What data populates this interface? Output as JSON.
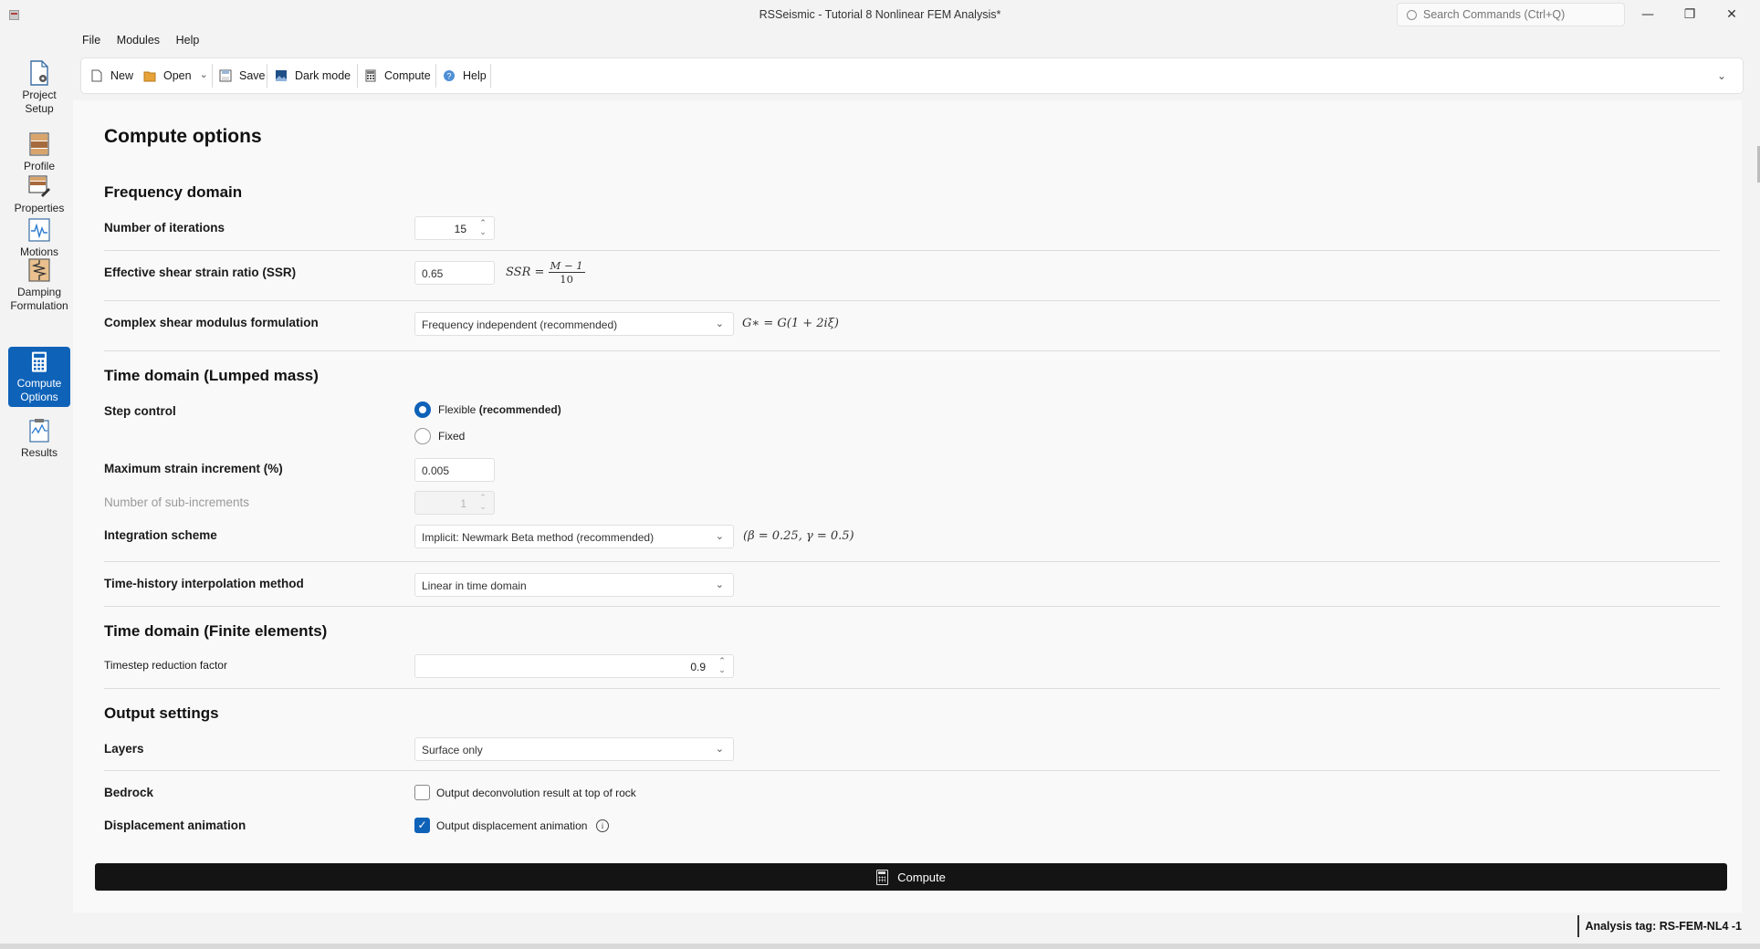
{
  "window": {
    "title": "RSSeismic - Tutorial 8 Nonlinear FEM Analysis*",
    "search_placeholder": "Search Commands (Ctrl+Q)",
    "minimize": "—",
    "restore": "❐",
    "close": "✕"
  },
  "menu": {
    "file": "File",
    "modules": "Modules",
    "help": "Help"
  },
  "toolbar": {
    "new": "New",
    "open": "Open",
    "save": "Save",
    "dark_mode": "Dark mode",
    "compute": "Compute",
    "help": "Help"
  },
  "nav": {
    "project_setup": "Project Setup",
    "profile": "Profile",
    "properties": "Properties",
    "motions": "Motions",
    "damping_formulation": "Damping Formulation",
    "compute_options": "Compute Options",
    "results": "Results"
  },
  "page": {
    "title": "Compute options",
    "frequency": {
      "heading": "Frequency domain",
      "iterations_label": "Number of iterations",
      "iterations_value": "15",
      "ssr_label": "Effective shear strain ratio (SSR)",
      "ssr_value": "0.65",
      "ssr_formula_lhs": "SSR =",
      "ssr_formula_num": "M − 1",
      "ssr_formula_den": "10",
      "modulus_label": "Complex shear modulus formulation",
      "modulus_value": "Frequency independent (recommended)",
      "modulus_formula": "G∗ = G(1 + 2iξ)"
    },
    "lumped": {
      "heading": "Time domain (Lumped mass)",
      "step_label": "Step control",
      "flexible_label": "Flexible",
      "flexible_suffix": "(recommended)",
      "fixed_label": "Fixed",
      "max_strain_label": "Maximum strain increment (%)",
      "max_strain_value": "0.005",
      "subincrements_label": "Number of sub-increments",
      "subincrements_value": "1",
      "integration_label": "Integration scheme",
      "integration_value": "Implicit: Newmark Beta method (recommended)",
      "integration_formula": "(β = 0.25, γ = 0.5)",
      "interp_label": "Time-history interpolation method",
      "interp_value": "Linear in time domain"
    },
    "finite": {
      "heading": "Time domain (Finite elements)",
      "timestep_label": "Timestep reduction factor",
      "timestep_value": "0.9"
    },
    "output": {
      "heading": "Output settings",
      "layers_label": "Layers",
      "layers_value": "Surface only",
      "bedrock_label": "Bedrock",
      "bedrock_checkbox": "Output deconvolution result at top of rock",
      "bedrock_checked": false,
      "anim_label": "Displacement animation",
      "anim_checkbox": "Output displacement animation",
      "anim_checked": true,
      "info_glyph": "i"
    },
    "compute_button": "Compute"
  },
  "status": {
    "analysis_tag": "Analysis tag: RS-FEM-NL4 -1"
  },
  "icons": {
    "arrow_up": "⌃",
    "arrow_down": "⌄",
    "chevron": "⌄",
    "check": "✓"
  },
  "colors": {
    "accent": "#0e62b8",
    "compute_bar": "#141414"
  }
}
